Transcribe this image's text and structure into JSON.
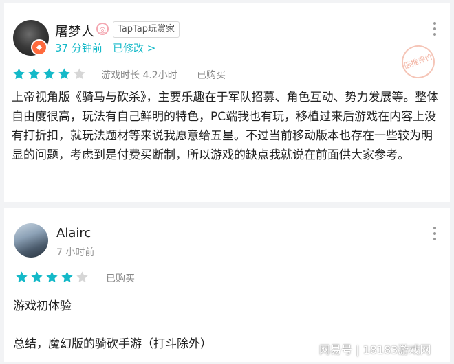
{
  "reviews": [
    {
      "username": "屠梦人",
      "badge": "TapTap玩赏家",
      "time": "37 分钟前",
      "edited": "已修改 >",
      "stamp": "倍推评价",
      "rating": 4,
      "playtime": "游戏时长 4.2小时",
      "purchased": "已购买",
      "text": "上帝视角版《骑马与砍杀》，主要乐趣在于军队招募、角色互动、势力发展等。整体自由度很高，玩法有自己鲜明的特色，PC端我也有玩，移植过来后游戏在内容上没有打折扣，就玩法题材等来说我愿意给五星。不过当前移动版本也存在一些较为明显的问题，考虑到是付费买断制，所以游戏的缺点我就说在前面供大家参考。"
    },
    {
      "username": "Alairc",
      "time": "7 小时前",
      "rating": 4,
      "purchased": "已购买",
      "line1": "游戏初体验",
      "line2": "总结，魔幻版的骑砍手游（打斗除外）"
    }
  ],
  "watermark": "网易号 | 18183游戏网",
  "colors": {
    "accent": "#14b9c8",
    "star_on": "#14b9c8",
    "star_off": "#d6d6d6"
  },
  "icons": [
    "verify-icon",
    "more-icon",
    "star-icon",
    "official-badge-icon"
  ]
}
